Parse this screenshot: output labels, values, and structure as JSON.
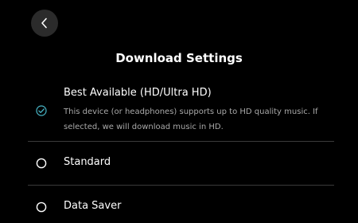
{
  "header": {
    "back_icon": "chevron-left-icon",
    "title": "Download Settings"
  },
  "options": [
    {
      "label": "Best Available (HD/Ultra HD)",
      "description": "This device (or headphones) supports up to HD quality music. If selected, we will download music in HD.",
      "selected": true,
      "icon": "check-circle-icon"
    },
    {
      "label": "Standard",
      "selected": false,
      "icon": "radio-unselected-icon"
    },
    {
      "label": "Data Saver",
      "selected": false,
      "icon": "radio-unselected-icon"
    }
  ],
  "colors": {
    "background": "#000000",
    "text": "#ffffff",
    "secondary_text": "#a9a9a9",
    "accent": "#48b6c7",
    "back_button_bg": "#2b2b2b",
    "divider": "#3a3a3a"
  }
}
